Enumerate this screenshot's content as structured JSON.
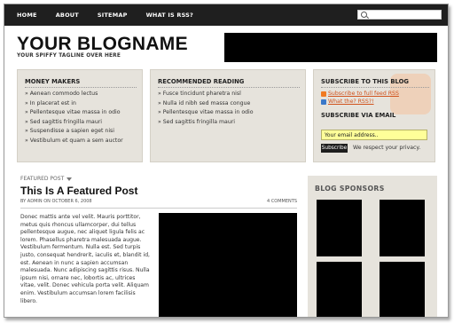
{
  "nav": {
    "items": [
      "HOME",
      "ABOUT",
      "SITEMAP",
      "WHAT IS RSS?"
    ]
  },
  "search": {
    "placeholder": ""
  },
  "header": {
    "blog_name": "YOUR BLOGNAME",
    "tagline": "YOUR SPIFFY TAGLINE OVER HERE"
  },
  "features": {
    "money_makers": {
      "title": "MONEY MAKERS",
      "items": [
        "» Aenean commodo lectus",
        "» In placerat est in",
        "» Pellentesque vitae massa in odio",
        "» Sed sagittis fringilla mauri",
        "» Suspendisse a sapien eget nisi",
        "» Vestibulum et quam a sem auctor"
      ]
    },
    "recommended": {
      "title": "RECOMMENDED READING",
      "items": [
        "» Fusce tincidunt pharetra nisl",
        "» Nulla id nibh sed massa congue",
        "» Pellentesque vitae massa in odio",
        "» Sed sagittis fringilla mauri"
      ]
    },
    "subscribe": {
      "title": "SUBSCRIBE TO THIS BLOG",
      "full_feed": "Subscribe to full feed RSS",
      "what_is_rss": "What the? RSS?!",
      "via_email_title": "SUBSCRIBE VIA EMAIL",
      "email_value": "Your email address..",
      "button": "Subscribe",
      "privacy": "We respect your privacy."
    }
  },
  "main": {
    "featured_label": "FEATURED POST",
    "post_title": "This Is A Featured Post",
    "post_meta": "BY ADMIN ON OCTOBER 6, 2008",
    "comments": "4 COMMENTS",
    "excerpt": "Donec mattis ante vel velit. Mauris porttitor, metus quis rhoncus ullamcorper, dui tellus pellentesque augue, nec aliquet ligula felis ac lorem. Phasellus pharetra malesuada augue. Vestibulum fermentum. Nulla est. Sed turpis justo, consequat hendrerit, iaculis et, blandit id, est. Aenean in nunc a sapien accumsan malesuada. Nunc adipiscing sagittis risus. Nulla ipsum nisi, ornare nec, lobortis ac, ultrices vitae, velit. Donec vehicula porta velit. Aliquam enim. Vestibulum accumsan lorem facilisis libero."
  },
  "sidebar": {
    "title": "BLOG SPONSORS"
  },
  "colors": {
    "topbar": "#1f1f1f",
    "feature_bg": "#e6e3dc",
    "rss_orange": "#f07a22",
    "email_field": "#ffff99"
  }
}
